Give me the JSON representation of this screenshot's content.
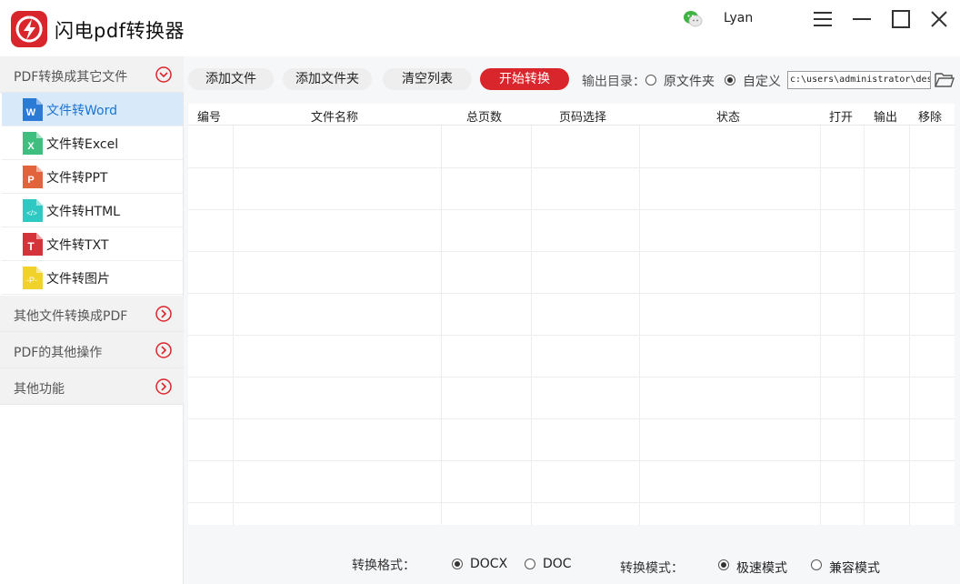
{
  "app": {
    "title": "闪电pdf转换器",
    "username": "Lyan",
    "brand_color": "#d9262c"
  },
  "window_controls": [
    "menu-icon",
    "minimize-icon",
    "maximize-icon",
    "close-icon"
  ],
  "sidebar": {
    "sections": [
      {
        "label": "PDF转换成其它文件",
        "expanded": true
      },
      {
        "label": "其他文件转换成PDF",
        "expanded": false
      },
      {
        "label": "PDF的其他操作",
        "expanded": false
      },
      {
        "label": "其他功能",
        "expanded": false
      }
    ],
    "items": [
      {
        "label": "文件转Word",
        "icon": "word-file-icon",
        "color": "#2b7bd6",
        "letter": "W",
        "active": true
      },
      {
        "label": "文件转Excel",
        "icon": "excel-file-icon",
        "color": "#3fbf7f",
        "letter": "X"
      },
      {
        "label": "文件转PPT",
        "icon": "ppt-file-icon",
        "color": "#e2633c",
        "letter": "P"
      },
      {
        "label": "文件转HTML",
        "icon": "html-file-icon",
        "color": "#2ec9c2",
        "letter": "</>"
      },
      {
        "label": "文件转TXT",
        "icon": "txt-file-icon",
        "color": "#d6323a",
        "letter": "T"
      },
      {
        "label": "文件转图片",
        "icon": "image-file-icon",
        "color": "#f0d22a",
        "letter": "P"
      }
    ]
  },
  "toolbar": {
    "add_file": "添加文件",
    "add_folder": "添加文件夹",
    "clear_list": "清空列表",
    "start": "开始转换",
    "output_dir_label": "输出目录：",
    "option_source": "原文件夹",
    "option_custom": "自定义",
    "selected_output": "自定义",
    "path": "c:\\users\\administrator\\desktop"
  },
  "table": {
    "columns": [
      "编号",
      "文件名称",
      "总页数",
      "页码选择",
      "状态",
      "打开",
      "输出",
      "移除"
    ],
    "rows": []
  },
  "options": {
    "format_label": "转换格式：",
    "formats": [
      "DOCX",
      "DOC"
    ],
    "selected_format": "DOCX",
    "mode_label": "转换模式：",
    "modes": [
      "极速模式",
      "兼容模式"
    ],
    "selected_mode": "极速模式"
  }
}
